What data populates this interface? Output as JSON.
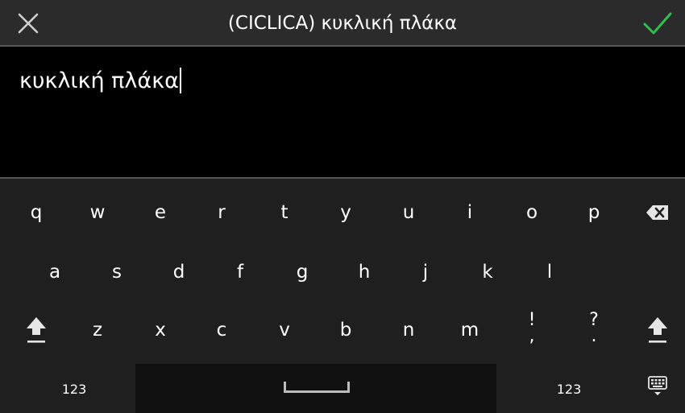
{
  "header": {
    "title": "(CICLICA) κυκλική πλάκα",
    "close_icon": "close-icon",
    "confirm_icon": "checkmark-icon",
    "confirm_color": "#2fbf4f"
  },
  "input": {
    "value": "κυκλική πλάκα"
  },
  "keyboard": {
    "row1": [
      "q",
      "w",
      "e",
      "r",
      "t",
      "y",
      "u",
      "i",
      "o",
      "p"
    ],
    "row2": [
      "a",
      "s",
      "d",
      "f",
      "g",
      "h",
      "j",
      "k",
      "l"
    ],
    "row3": [
      "z",
      "x",
      "c",
      "v",
      "b",
      "n",
      "m"
    ],
    "punct1": {
      "top": "!",
      "bottom": ","
    },
    "punct2": {
      "top": "?",
      "bottom": "."
    },
    "numbers_left": "123",
    "numbers_right": "123",
    "icons": {
      "backspace": "backspace-icon",
      "shift": "shift-icon",
      "space": "space-bar-icon",
      "hide_keyboard": "keyboard-hide-icon"
    }
  }
}
